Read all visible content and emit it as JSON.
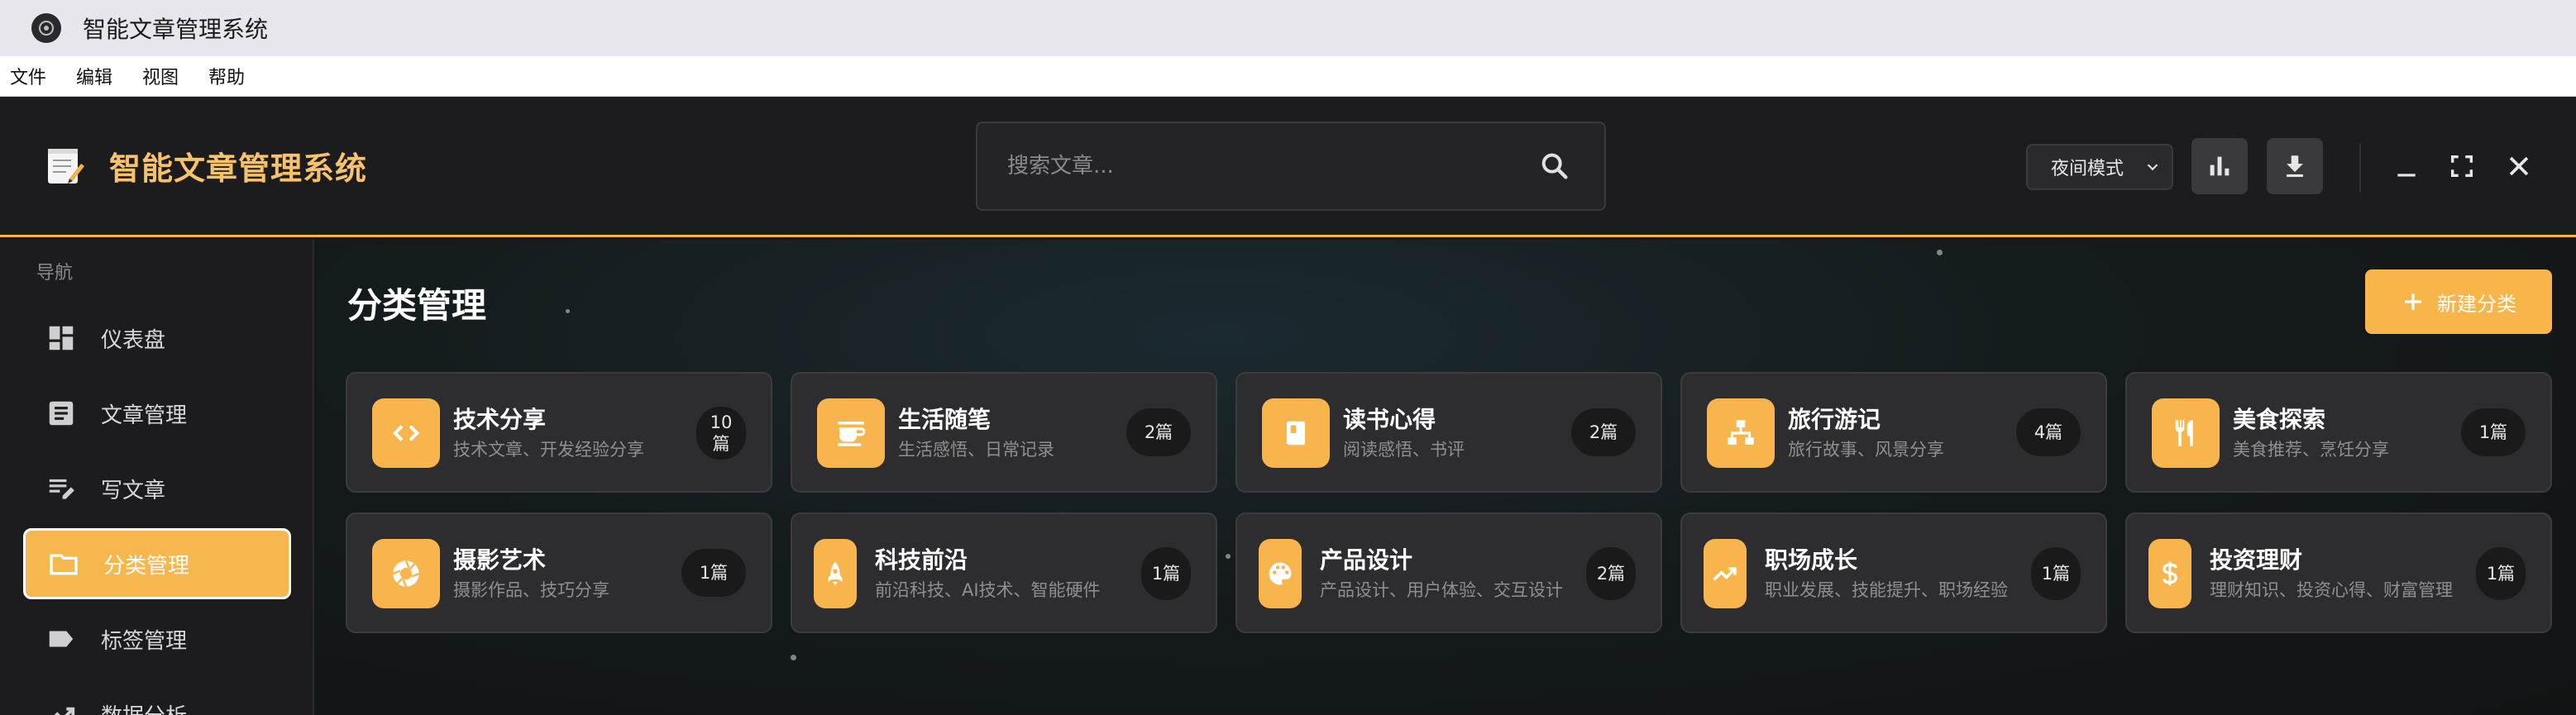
{
  "window": {
    "title": "智能文章管理系统"
  },
  "menubar": {
    "items": [
      "文件",
      "编辑",
      "视图",
      "帮助"
    ]
  },
  "header": {
    "brand_title": "智能文章管理系统",
    "search_placeholder": "搜索文章...",
    "mode_label": "夜间模式"
  },
  "sidebar": {
    "section_label": "导航",
    "items": [
      {
        "label": "仪表盘",
        "icon": "dashboard-icon"
      },
      {
        "label": "文章管理",
        "icon": "article-icon"
      },
      {
        "label": "写文章",
        "icon": "edit-note-icon"
      },
      {
        "label": "分类管理",
        "icon": "folder-icon",
        "active": true
      },
      {
        "label": "标签管理",
        "icon": "tag-icon"
      },
      {
        "label": "数据分析",
        "icon": "trend-icon"
      }
    ]
  },
  "main": {
    "title": "分类管理",
    "new_button_label": "新建分类",
    "categories": [
      {
        "title": "技术分享",
        "desc": "技术文章、开发经验分享",
        "count": "10篇",
        "icon": "code-icon"
      },
      {
        "title": "生活随笔",
        "desc": "生活感悟、日常记录",
        "count": "2篇",
        "icon": "coffee-icon"
      },
      {
        "title": "读书心得",
        "desc": "阅读感悟、书评",
        "count": "2篇",
        "icon": "book-icon"
      },
      {
        "title": "旅行游记",
        "desc": "旅行故事、风景分享",
        "count": "4篇",
        "icon": "sitemap-icon"
      },
      {
        "title": "美食探索",
        "desc": "美食推荐、烹饪分享",
        "count": "1篇",
        "icon": "restaurant-icon"
      },
      {
        "title": "摄影艺术",
        "desc": "摄影作品、技巧分享",
        "count": "1篇",
        "icon": "camera-icon"
      },
      {
        "title": "科技前沿",
        "desc": "前沿科技、AI技术、智能硬件",
        "count": "1篇",
        "icon": "rocket-icon"
      },
      {
        "title": "产品设计",
        "desc": "产品设计、用户体验、交互设计",
        "count": "2篇",
        "icon": "palette-icon"
      },
      {
        "title": "职场成长",
        "desc": "职业发展、技能提升、职场经验",
        "count": "1篇",
        "icon": "trending-up-icon"
      },
      {
        "title": "投资理财",
        "desc": "理财知识、投资心得、财富管理",
        "count": "1篇",
        "icon": "dollar-icon"
      }
    ]
  },
  "colors": {
    "accent": "#f6b84e",
    "brand_text": "#f6c26b",
    "card_bg": "#2d2d2f"
  }
}
